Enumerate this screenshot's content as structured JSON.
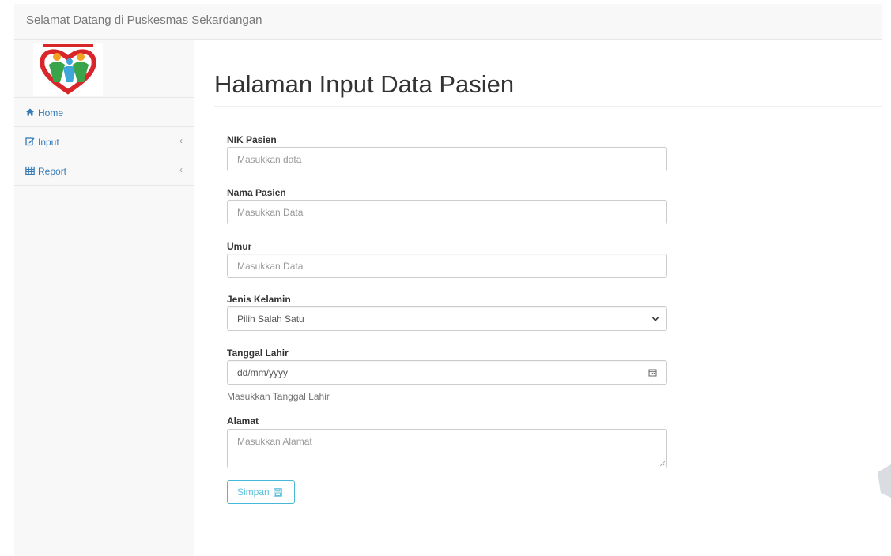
{
  "header": {
    "brand": "Selamat Datang di Puskesmas Sekardangan"
  },
  "sidebar": {
    "items": [
      {
        "label": "Home",
        "icon": "home-icon"
      },
      {
        "label": "Input",
        "icon": "edit-icon",
        "chevron": "‹"
      },
      {
        "label": "Report",
        "icon": "table-icon",
        "chevron": "‹"
      }
    ]
  },
  "main": {
    "title": "Halaman Input Data Pasien",
    "fields": {
      "nik": {
        "label": "NIK Pasien",
        "placeholder": "Masukkan data"
      },
      "nama": {
        "label": "Nama Pasien",
        "placeholder": "Masukkan Data"
      },
      "umur": {
        "label": "Umur",
        "placeholder": "Masukkan Data"
      },
      "jenis_kelamin": {
        "label": "Jenis Kelamin",
        "selected": "Pilih Salah Satu"
      },
      "tanggal_lahir": {
        "label": "Tanggal Lahir",
        "placeholder": "dd/mm/yyyy",
        "help": "Masukkan Tanggal Lahir"
      },
      "alamat": {
        "label": "Alamat",
        "placeholder": "Masukkan Alamat"
      }
    },
    "submit_label": "Simpan"
  },
  "colors": {
    "link": "#337ab7",
    "button_info": "#5bc0de",
    "logo_red": "#d8262b",
    "logo_green": "#3aa44a",
    "logo_orange": "#f2a123",
    "logo_blue": "#3fa6dc"
  }
}
